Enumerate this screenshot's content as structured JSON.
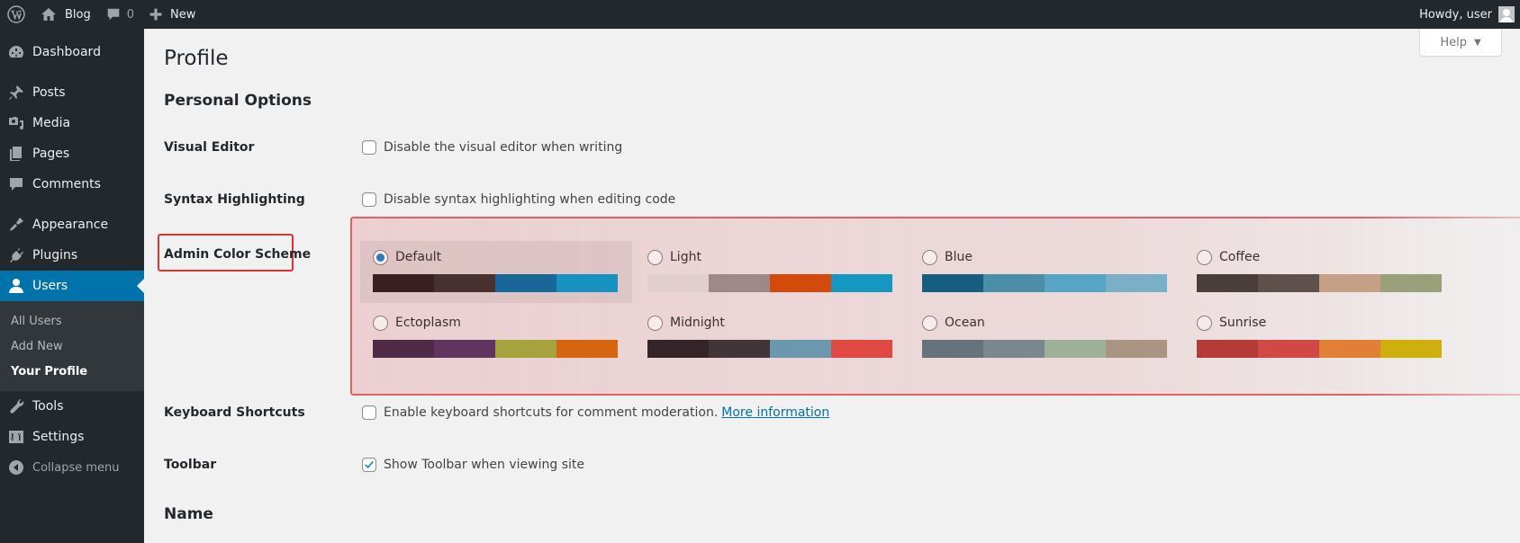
{
  "adminbar": {
    "site_name": "Blog",
    "comments_count": "0",
    "new_label": "New",
    "howdy": "Howdy, user",
    "icons": [
      "wordpress-logo-icon",
      "home-icon",
      "comment-icon",
      "plus-icon",
      "avatar"
    ]
  },
  "sidebar": {
    "items": [
      {
        "label": "Dashboard",
        "icon": "dashboard-icon"
      },
      {
        "label": "Posts",
        "icon": "pin-icon"
      },
      {
        "label": "Media",
        "icon": "media-icon"
      },
      {
        "label": "Pages",
        "icon": "pages-icon"
      },
      {
        "label": "Comments",
        "icon": "comment-icon"
      },
      {
        "label": "Appearance",
        "icon": "brush-icon"
      },
      {
        "label": "Plugins",
        "icon": "plug-icon"
      },
      {
        "label": "Users",
        "icon": "user-icon",
        "active": true
      },
      {
        "label": "Tools",
        "icon": "wrench-icon"
      },
      {
        "label": "Settings",
        "icon": "settings-icon"
      }
    ],
    "users_submenu": [
      {
        "label": "All Users"
      },
      {
        "label": "Add New"
      },
      {
        "label": "Your Profile",
        "current": true
      }
    ],
    "collapse_label": "Collapse menu",
    "active_color": "#0073aa"
  },
  "page": {
    "help_label": "Help",
    "title": "Profile",
    "personal_options_heading": "Personal Options",
    "visual_editor": {
      "label": "Visual Editor",
      "option": "Disable the visual editor when writing",
      "checked": false
    },
    "syntax_highlighting": {
      "label": "Syntax Highlighting",
      "option": "Disable syntax highlighting when editing code",
      "checked": false
    },
    "admin_color_scheme": {
      "label": "Admin Color Scheme",
      "selected": "Default",
      "schemes": [
        {
          "name": "Default",
          "colors": [
            "#3a1f20",
            "#482f30",
            "#186799",
            "#1592c0"
          ]
        },
        {
          "name": "Light",
          "colors": [
            "#e1cfd0",
            "#9e8988",
            "#d44a0b",
            "#1497c0"
          ]
        },
        {
          "name": "Blue",
          "colors": [
            "#155e80",
            "#4a8ea8",
            "#56a5c5",
            "#79afc7"
          ]
        },
        {
          "name": "Coffee",
          "colors": [
            "#4a3e3b",
            "#5e514c",
            "#c5a087",
            "#9aa17a"
          ]
        },
        {
          "name": "Ectoplasm",
          "colors": [
            "#512a4a",
            "#5f3560",
            "#a6a33e",
            "#d5660f"
          ]
        },
        {
          "name": "Midnight",
          "colors": [
            "#35252a",
            "#423539",
            "#6b98ac",
            "#e04a43"
          ]
        },
        {
          "name": "Ocean",
          "colors": [
            "#66737a",
            "#7a878d",
            "#9fb198",
            "#aa9582"
          ]
        },
        {
          "name": "Sunrise",
          "colors": [
            "#b53b36",
            "#d14844",
            "#e08036",
            "#ceaf0b"
          ]
        }
      ]
    },
    "keyboard_shortcuts": {
      "label": "Keyboard Shortcuts",
      "option": "Enable keyboard shortcuts for comment moderation.",
      "link": "More information",
      "checked": false
    },
    "toolbar": {
      "label": "Toolbar",
      "option": "Show Toolbar when viewing site",
      "checked": true
    },
    "name_heading": "Name",
    "highlight_color": "#d63638"
  }
}
